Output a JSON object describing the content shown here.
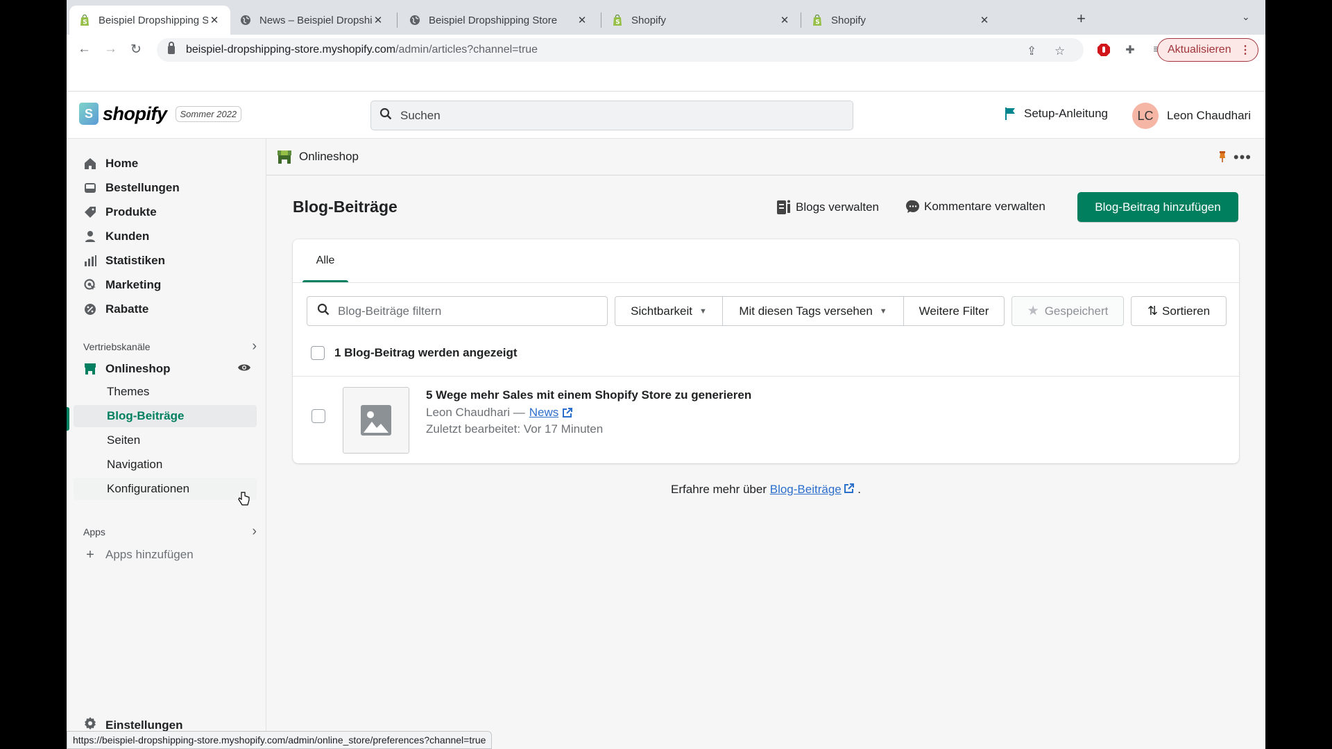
{
  "browser": {
    "tabs": [
      {
        "title": "Beispiel Dropshipping Store · B",
        "icon": "shopify-icon",
        "active": true
      },
      {
        "title": "News – Beispiel Dropshipping S",
        "icon": "globe-icon",
        "active": false
      },
      {
        "title": "Beispiel Dropshipping Store",
        "icon": "globe-icon",
        "active": false
      },
      {
        "title": "Shopify",
        "icon": "shopify-icon",
        "active": false
      },
      {
        "title": "Shopify",
        "icon": "shopify-icon",
        "active": false
      }
    ],
    "url_host": "beispiel-dropshipping-store.myshopify.com",
    "url_path": "/admin/articles?channel=true",
    "update_button": "Aktualisieren",
    "status_url": "https://beispiel-dropshipping-store.myshopify.com/admin/online_store/preferences?channel=true"
  },
  "header": {
    "logo_text": "shopify",
    "edition_badge": "Sommer 2022",
    "search_placeholder": "Suchen",
    "setup_label": "Setup-Anleitung",
    "user_initials": "LC",
    "user_name": "Leon Chaudhari"
  },
  "sidebar": {
    "items": [
      {
        "label": "Home",
        "icon": "home-icon"
      },
      {
        "label": "Bestellungen",
        "icon": "orders-icon"
      },
      {
        "label": "Produkte",
        "icon": "tag-icon"
      },
      {
        "label": "Kunden",
        "icon": "person-icon"
      },
      {
        "label": "Statistiken",
        "icon": "bar-chart-icon"
      },
      {
        "label": "Marketing",
        "icon": "target-icon"
      },
      {
        "label": "Rabatte",
        "icon": "discount-icon"
      }
    ],
    "sales_channels_label": "Vertriebskanäle",
    "channel": "Onlineshop",
    "sub_items": [
      "Themes",
      "Blog-Beiträge",
      "Seiten",
      "Navigation",
      "Konfigurationen"
    ],
    "active_sub_item": "Blog-Beiträge",
    "apps_label": "Apps",
    "add_apps_label": "Apps hinzufügen",
    "settings_label": "Einstellungen"
  },
  "main": {
    "channel_bar_title": "Onlineshop",
    "page_title": "Blog-Beiträge",
    "manage_blogs": "Blogs verwalten",
    "manage_comments": "Kommentare verwalten",
    "add_post": "Blog-Beitrag hinzufügen",
    "tabs": [
      "Alle"
    ],
    "filter_placeholder": "Blog-Beiträge filtern",
    "filters": {
      "visibility": "Sichtbarkeit",
      "tags": "Mit diesen Tags versehen",
      "more": "Weitere Filter",
      "saved": "Gespeichert",
      "sort": "Sortieren"
    },
    "count_text": "1 Blog-Beitrag werden angezeigt",
    "posts": [
      {
        "title": "5 Wege mehr Sales mit einem Shopify Store zu generieren",
        "author": "Leon Chaudhari —",
        "blog": "News",
        "edited": "Zuletzt bearbeitet: Vor 17 Minuten"
      }
    ],
    "learn_prefix": "Erfahre mehr über",
    "learn_link": "Blog-Beiträge",
    "learn_suffix": "."
  },
  "colors": {
    "primary": "#007f5f",
    "active_nav": "#008060",
    "link": "#2c6ecb"
  }
}
